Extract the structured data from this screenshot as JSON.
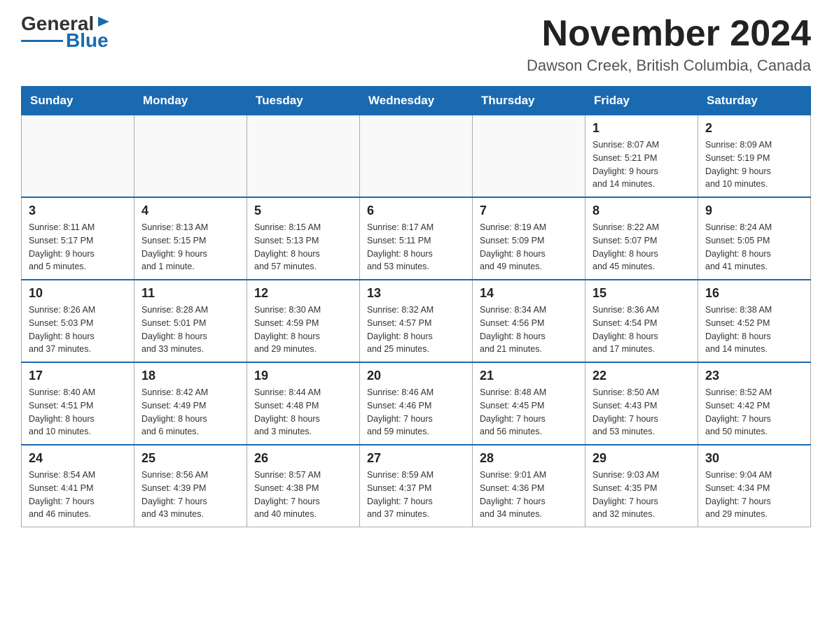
{
  "header": {
    "logo_general": "General",
    "logo_blue": "Blue",
    "month_title": "November 2024",
    "location": "Dawson Creek, British Columbia, Canada"
  },
  "weekdays": [
    "Sunday",
    "Monday",
    "Tuesday",
    "Wednesday",
    "Thursday",
    "Friday",
    "Saturday"
  ],
  "weeks": [
    [
      {
        "day": "",
        "info": ""
      },
      {
        "day": "",
        "info": ""
      },
      {
        "day": "",
        "info": ""
      },
      {
        "day": "",
        "info": ""
      },
      {
        "day": "",
        "info": ""
      },
      {
        "day": "1",
        "info": "Sunrise: 8:07 AM\nSunset: 5:21 PM\nDaylight: 9 hours\nand 14 minutes."
      },
      {
        "day": "2",
        "info": "Sunrise: 8:09 AM\nSunset: 5:19 PM\nDaylight: 9 hours\nand 10 minutes."
      }
    ],
    [
      {
        "day": "3",
        "info": "Sunrise: 8:11 AM\nSunset: 5:17 PM\nDaylight: 9 hours\nand 5 minutes."
      },
      {
        "day": "4",
        "info": "Sunrise: 8:13 AM\nSunset: 5:15 PM\nDaylight: 9 hours\nand 1 minute."
      },
      {
        "day": "5",
        "info": "Sunrise: 8:15 AM\nSunset: 5:13 PM\nDaylight: 8 hours\nand 57 minutes."
      },
      {
        "day": "6",
        "info": "Sunrise: 8:17 AM\nSunset: 5:11 PM\nDaylight: 8 hours\nand 53 minutes."
      },
      {
        "day": "7",
        "info": "Sunrise: 8:19 AM\nSunset: 5:09 PM\nDaylight: 8 hours\nand 49 minutes."
      },
      {
        "day": "8",
        "info": "Sunrise: 8:22 AM\nSunset: 5:07 PM\nDaylight: 8 hours\nand 45 minutes."
      },
      {
        "day": "9",
        "info": "Sunrise: 8:24 AM\nSunset: 5:05 PM\nDaylight: 8 hours\nand 41 minutes."
      }
    ],
    [
      {
        "day": "10",
        "info": "Sunrise: 8:26 AM\nSunset: 5:03 PM\nDaylight: 8 hours\nand 37 minutes."
      },
      {
        "day": "11",
        "info": "Sunrise: 8:28 AM\nSunset: 5:01 PM\nDaylight: 8 hours\nand 33 minutes."
      },
      {
        "day": "12",
        "info": "Sunrise: 8:30 AM\nSunset: 4:59 PM\nDaylight: 8 hours\nand 29 minutes."
      },
      {
        "day": "13",
        "info": "Sunrise: 8:32 AM\nSunset: 4:57 PM\nDaylight: 8 hours\nand 25 minutes."
      },
      {
        "day": "14",
        "info": "Sunrise: 8:34 AM\nSunset: 4:56 PM\nDaylight: 8 hours\nand 21 minutes."
      },
      {
        "day": "15",
        "info": "Sunrise: 8:36 AM\nSunset: 4:54 PM\nDaylight: 8 hours\nand 17 minutes."
      },
      {
        "day": "16",
        "info": "Sunrise: 8:38 AM\nSunset: 4:52 PM\nDaylight: 8 hours\nand 14 minutes."
      }
    ],
    [
      {
        "day": "17",
        "info": "Sunrise: 8:40 AM\nSunset: 4:51 PM\nDaylight: 8 hours\nand 10 minutes."
      },
      {
        "day": "18",
        "info": "Sunrise: 8:42 AM\nSunset: 4:49 PM\nDaylight: 8 hours\nand 6 minutes."
      },
      {
        "day": "19",
        "info": "Sunrise: 8:44 AM\nSunset: 4:48 PM\nDaylight: 8 hours\nand 3 minutes."
      },
      {
        "day": "20",
        "info": "Sunrise: 8:46 AM\nSunset: 4:46 PM\nDaylight: 7 hours\nand 59 minutes."
      },
      {
        "day": "21",
        "info": "Sunrise: 8:48 AM\nSunset: 4:45 PM\nDaylight: 7 hours\nand 56 minutes."
      },
      {
        "day": "22",
        "info": "Sunrise: 8:50 AM\nSunset: 4:43 PM\nDaylight: 7 hours\nand 53 minutes."
      },
      {
        "day": "23",
        "info": "Sunrise: 8:52 AM\nSunset: 4:42 PM\nDaylight: 7 hours\nand 50 minutes."
      }
    ],
    [
      {
        "day": "24",
        "info": "Sunrise: 8:54 AM\nSunset: 4:41 PM\nDaylight: 7 hours\nand 46 minutes."
      },
      {
        "day": "25",
        "info": "Sunrise: 8:56 AM\nSunset: 4:39 PM\nDaylight: 7 hours\nand 43 minutes."
      },
      {
        "day": "26",
        "info": "Sunrise: 8:57 AM\nSunset: 4:38 PM\nDaylight: 7 hours\nand 40 minutes."
      },
      {
        "day": "27",
        "info": "Sunrise: 8:59 AM\nSunset: 4:37 PM\nDaylight: 7 hours\nand 37 minutes."
      },
      {
        "day": "28",
        "info": "Sunrise: 9:01 AM\nSunset: 4:36 PM\nDaylight: 7 hours\nand 34 minutes."
      },
      {
        "day": "29",
        "info": "Sunrise: 9:03 AM\nSunset: 4:35 PM\nDaylight: 7 hours\nand 32 minutes."
      },
      {
        "day": "30",
        "info": "Sunrise: 9:04 AM\nSunset: 4:34 PM\nDaylight: 7 hours\nand 29 minutes."
      }
    ]
  ]
}
